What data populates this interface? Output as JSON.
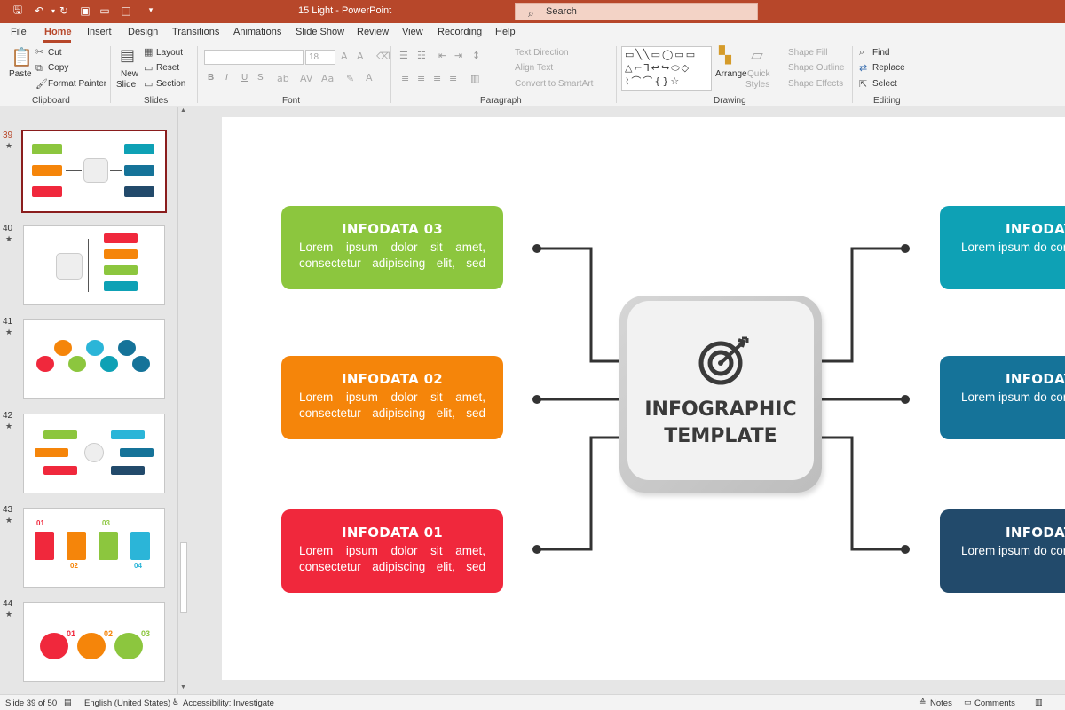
{
  "app": {
    "doc_name": "15 Light",
    "app_name": "PowerPoint",
    "title_sep": " - "
  },
  "search": {
    "placeholder": "Search"
  },
  "tabs": [
    "File",
    "Home",
    "Insert",
    "Design",
    "Transitions",
    "Animations",
    "Slide Show",
    "Review",
    "View",
    "Recording",
    "Help"
  ],
  "ribbon": {
    "clipboard": {
      "paste": "Paste",
      "cut": "Cut",
      "copy": "Copy",
      "format_painter": "Format Painter",
      "label": "Clipboard"
    },
    "slides": {
      "new_slide_1": "New",
      "new_slide_2": "Slide",
      "layout": "Layout",
      "reset": "Reset",
      "section": "Section",
      "label": "Slides"
    },
    "font": {
      "size": "18",
      "bold": "B",
      "italic": "I",
      "underline": "U",
      "strike": "S",
      "label": "Font"
    },
    "paragraph": {
      "text_direction": "Text Direction",
      "align_text": "Align Text",
      "smartart": "Convert to SmartArt",
      "label": "Paragraph"
    },
    "drawing": {
      "arrange": "Arrange",
      "quick_styles_1": "Quick",
      "quick_styles_2": "Styles",
      "shape_fill": "Shape Fill",
      "shape_outline": "Shape Outline",
      "shape_effects": "Shape Effects",
      "label": "Drawing"
    },
    "editing": {
      "find": "Find",
      "replace": "Replace",
      "select": "Select",
      "label": "Editing"
    }
  },
  "thumbnails": [
    {
      "num": "39",
      "star": "★"
    },
    {
      "num": "40",
      "star": "★"
    },
    {
      "num": "41",
      "star": "★"
    },
    {
      "num": "42",
      "star": "★"
    },
    {
      "num": "43",
      "star": "★"
    },
    {
      "num": "44",
      "star": "★"
    }
  ],
  "thumb_numbers": {
    "t43": [
      "01",
      "02",
      "03",
      "04"
    ],
    "t44": [
      "01",
      "02",
      "03"
    ]
  },
  "slide": {
    "center_title": "INFOGRAPHIC\nTEMPLATE",
    "cards": [
      {
        "title": "INFODATA 03",
        "body": "Lorem ipsum dolor sit amet, consectetur adipiscing elit, sed",
        "color": "#8cc63e"
      },
      {
        "title": "INFODATA 02",
        "body": "Lorem ipsum dolor sit amet, consectetur adipiscing elit, sed",
        "color": "#f5850a"
      },
      {
        "title": "INFODATA 01",
        "body": "Lorem ipsum dolor sit amet, consectetur adipiscing elit, sed",
        "color": "#f0283c"
      },
      {
        "title": "INFODAT",
        "body": "Lorem ipsum do consectetur adipis",
        "color": "#0ea1b5"
      },
      {
        "title": "INFODAT",
        "body": "Lorem ipsum do consectetur adipis",
        "color": "#157399"
      },
      {
        "title": "INFODAT",
        "body": "Lorem ipsum do consectetur adipis",
        "color": "#224a6b"
      }
    ]
  },
  "status": {
    "slide_info": "Slide 39 of 50",
    "language": "English (United States)",
    "accessibility": "Accessibility: Investigate",
    "notes": "Notes",
    "comments": "Comments"
  },
  "colors": {
    "accent": "#b7472a",
    "selected_thumb_border": "#8a1d1d",
    "connector": "#333333"
  }
}
